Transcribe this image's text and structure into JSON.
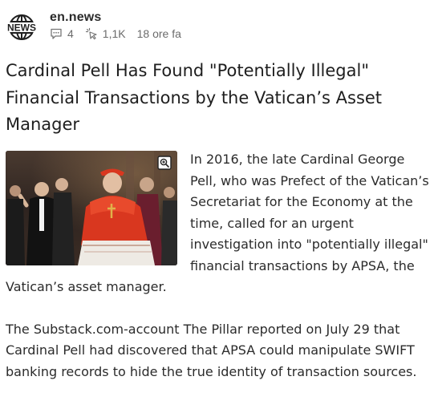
{
  "source": {
    "logo_text": "NEWS",
    "name": "en.news"
  },
  "meta": {
    "comments_icon": "comment-icon",
    "comments_count": "4",
    "views_icon": "pointer-click-icon",
    "views_count": "1,1K",
    "time_ago": "18 ore fa"
  },
  "article": {
    "title": "Cardinal Pell Has Found \"Potentially Illegal\" Financial Transactions by the Vatican’s Asset Manager",
    "image_zoom_icon": "zoom-in-icon",
    "paragraphs": [
      "In 2016, the late Cardinal George Pell, who was Prefect of the Vatican’s Secretariat for the Economy at the time, called for an urgent investigation into \"potential­ly illegal\" financial transactions by APSA, the Vatican’s asset manager.",
      "The Substack.com-account The Pillar reported on July 29 that Cardinal Pell had discovered that APSA could manipulate SWIFT banking records to hide the true identity of transaction sources."
    ]
  },
  "colors": {
    "text": "#222222",
    "meta": "#6b6b6b",
    "cardinal_red": "#d9371f"
  }
}
